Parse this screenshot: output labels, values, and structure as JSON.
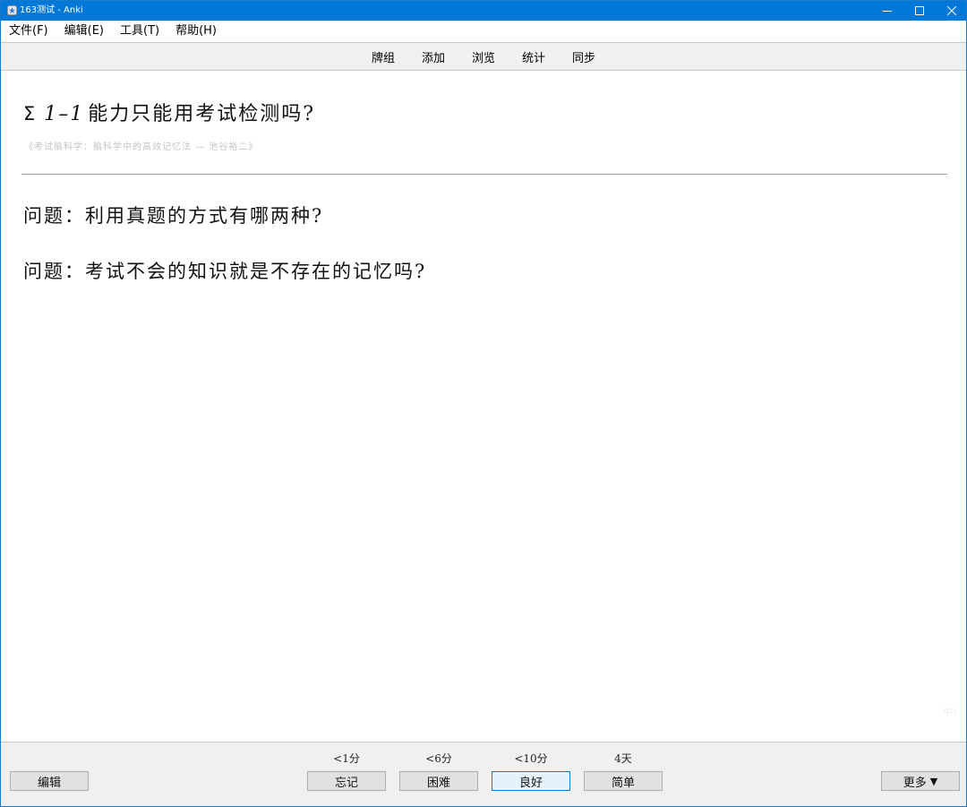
{
  "window": {
    "title": "163测试 - Anki",
    "colors": {
      "titlebar": "#0078d7",
      "toolbar_bg": "#f0f0f0",
      "source_text": "#c4c4c4"
    }
  },
  "menubar": {
    "items": [
      {
        "label": "文件(F)"
      },
      {
        "label": "编辑(E)"
      },
      {
        "label": "工具(T)"
      },
      {
        "label": "帮助(H)"
      }
    ]
  },
  "toolbar": {
    "links": [
      {
        "label": "牌组"
      },
      {
        "label": "添加"
      },
      {
        "label": "浏览"
      },
      {
        "label": "统计"
      },
      {
        "label": "同步"
      }
    ]
  },
  "card": {
    "title_symbol": "Σ",
    "title_number": "1–1",
    "title_text": "能力只能用考试检测吗?",
    "source": "《考试脑科学：脑科学中的高效记忆法 — 池谷裕二》",
    "questions": [
      "问题：利用真题的方式有哪两种?",
      "问题：考试不会的知识就是不存在的记忆吗?"
    ],
    "resize_handle": "::::"
  },
  "bottombar": {
    "edit_label": "编辑",
    "more_label": "更多",
    "more_arrow": "▼",
    "answers": [
      {
        "label": "忘记",
        "interval": "<1分"
      },
      {
        "label": "困难",
        "interval": "<6分"
      },
      {
        "label": "良好",
        "interval": "<10分"
      },
      {
        "label": "简单",
        "interval": "4天"
      }
    ]
  }
}
